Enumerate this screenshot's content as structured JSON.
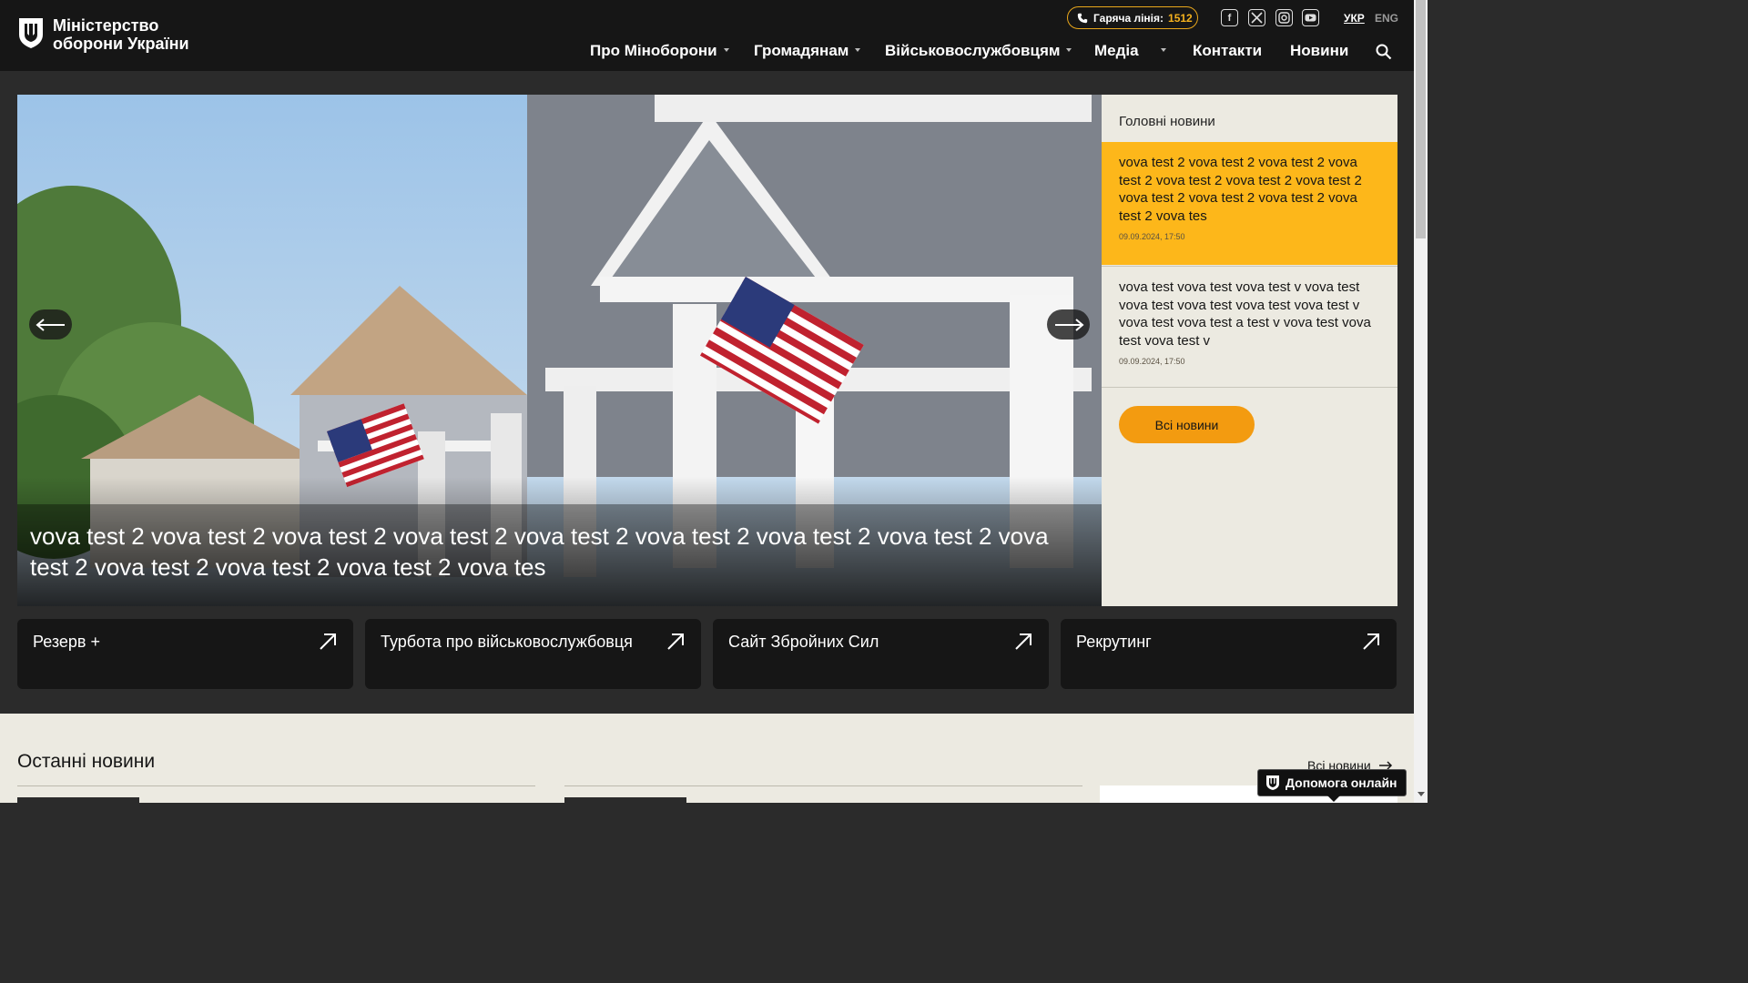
{
  "header": {
    "logo_line1": "Міністерство",
    "logo_line2": "оборони України",
    "hotline_label": "Гаряча лінія:",
    "hotline_number": "1512",
    "socials": [
      "facebook-icon",
      "x-twitter-icon",
      "instagram-icon",
      "youtube-icon"
    ],
    "lang_ukr": "УКР",
    "lang_eng": "ENG",
    "nav": [
      {
        "label": "Про Міноборони",
        "dropdown": true
      },
      {
        "label": "Громадянам",
        "dropdown": true
      },
      {
        "label": "Військовослужбовцям",
        "dropdown": true
      },
      {
        "label": "Медіа",
        "dropdown": true
      },
      {
        "label": "Контакти",
        "dropdown": false
      },
      {
        "label": "Новини",
        "dropdown": false
      }
    ]
  },
  "hero": {
    "caption": "vova test 2 vova test 2 vova test 2 vova test 2 vova test 2 vova test 2 vova test 2 vova test 2 vova test 2 vova test 2 vova test 2 vova test 2 vova tes"
  },
  "side_news": {
    "title": "Головні новини",
    "items": [
      {
        "text": "vova test 2 vova test 2 vova test 2 vova test 2 vova test 2 vova test 2 vova test 2 vova test 2 vova test 2 vova test 2 vova test 2 vova tes",
        "date": "09.09.2024, 17:50"
      },
      {
        "text": "vova test vova test vova test v vova test vova test vova test vova test vova test v vova test vova test a test v vova test vova test vova test v",
        "date": "09.09.2024, 17:50"
      }
    ],
    "all_news": "Всі новини"
  },
  "quick_links": [
    {
      "label": "Резерв +"
    },
    {
      "label": "Турбота про військовослужбовця"
    },
    {
      "label": "Сайт Збройних Сил"
    },
    {
      "label": "Рекрутинг"
    }
  ],
  "latest": {
    "title": "Останні новини",
    "all_news": "Всі новини"
  },
  "help_button": "Допомога онлайн",
  "colors": {
    "header_bg": "#161616",
    "accent_yellow": "#fdb71a",
    "accent_orange": "#f39b10",
    "beige": "#eceae1"
  }
}
